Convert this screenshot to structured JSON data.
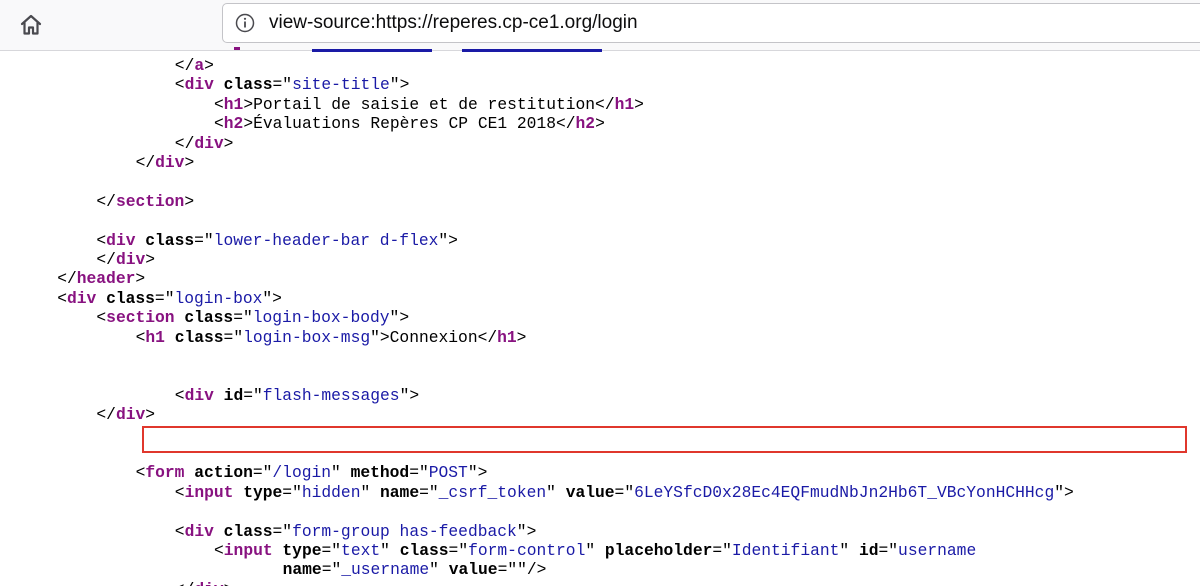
{
  "toolbar": {
    "home_icon": "home-icon",
    "info_icon": "info-circle-icon",
    "url": "view-source:https://reperes.cp-ce1.org/login"
  },
  "source_lines": [
    {
      "indent": 16,
      "parts": [
        {
          "c": "p",
          "t": "</"
        },
        {
          "c": "t",
          "t": "a"
        },
        {
          "c": "p",
          "t": ">"
        }
      ]
    },
    {
      "indent": 16,
      "parts": [
        {
          "c": "p",
          "t": "<"
        },
        {
          "c": "t",
          "t": "div "
        },
        {
          "c": "a",
          "t": "class"
        },
        {
          "c": "p",
          "t": "=\""
        },
        {
          "c": "v",
          "t": "site-title"
        },
        {
          "c": "p",
          "t": "\">"
        }
      ]
    },
    {
      "indent": 20,
      "parts": [
        {
          "c": "p",
          "t": "<"
        },
        {
          "c": "t",
          "t": "h1"
        },
        {
          "c": "p",
          "t": ">Portail de saisie et de restitution</"
        },
        {
          "c": "t",
          "t": "h1"
        },
        {
          "c": "p",
          "t": ">"
        }
      ]
    },
    {
      "indent": 20,
      "parts": [
        {
          "c": "p",
          "t": "<"
        },
        {
          "c": "t",
          "t": "h2"
        },
        {
          "c": "p",
          "t": ">Évaluations Repères CP CE1 2018</"
        },
        {
          "c": "t",
          "t": "h2"
        },
        {
          "c": "p",
          "t": ">"
        }
      ]
    },
    {
      "indent": 16,
      "parts": [
        {
          "c": "p",
          "t": "</"
        },
        {
          "c": "t",
          "t": "div"
        },
        {
          "c": "p",
          "t": ">"
        }
      ]
    },
    {
      "indent": 12,
      "parts": [
        {
          "c": "p",
          "t": "</"
        },
        {
          "c": "t",
          "t": "div"
        },
        {
          "c": "p",
          "t": ">"
        }
      ]
    },
    {
      "indent": 0,
      "parts": []
    },
    {
      "indent": 8,
      "parts": [
        {
          "c": "p",
          "t": "</"
        },
        {
          "c": "t",
          "t": "section"
        },
        {
          "c": "p",
          "t": ">"
        }
      ]
    },
    {
      "indent": 0,
      "parts": []
    },
    {
      "indent": 8,
      "parts": [
        {
          "c": "p",
          "t": "<"
        },
        {
          "c": "t",
          "t": "div "
        },
        {
          "c": "a",
          "t": "class"
        },
        {
          "c": "p",
          "t": "=\""
        },
        {
          "c": "v",
          "t": "lower-header-bar d-flex"
        },
        {
          "c": "p",
          "t": "\">"
        }
      ]
    },
    {
      "indent": 8,
      "parts": [
        {
          "c": "p",
          "t": "</"
        },
        {
          "c": "t",
          "t": "div"
        },
        {
          "c": "p",
          "t": ">"
        }
      ]
    },
    {
      "indent": 4,
      "parts": [
        {
          "c": "p",
          "t": "</"
        },
        {
          "c": "t",
          "t": "header"
        },
        {
          "c": "p",
          "t": ">"
        }
      ]
    },
    {
      "indent": 4,
      "parts": [
        {
          "c": "p",
          "t": "<"
        },
        {
          "c": "t",
          "t": "div "
        },
        {
          "c": "a",
          "t": "class"
        },
        {
          "c": "p",
          "t": "=\""
        },
        {
          "c": "v",
          "t": "login-box"
        },
        {
          "c": "p",
          "t": "\">"
        }
      ]
    },
    {
      "indent": 8,
      "parts": [
        {
          "c": "p",
          "t": "<"
        },
        {
          "c": "t",
          "t": "section "
        },
        {
          "c": "a",
          "t": "class"
        },
        {
          "c": "p",
          "t": "=\""
        },
        {
          "c": "v",
          "t": "login-box-body"
        },
        {
          "c": "p",
          "t": "\">"
        }
      ]
    },
    {
      "indent": 12,
      "parts": [
        {
          "c": "p",
          "t": "<"
        },
        {
          "c": "t",
          "t": "h1 "
        },
        {
          "c": "a",
          "t": "class"
        },
        {
          "c": "p",
          "t": "=\""
        },
        {
          "c": "v",
          "t": "login-box-msg"
        },
        {
          "c": "p",
          "t": "\">Connexion</"
        },
        {
          "c": "t",
          "t": "h1"
        },
        {
          "c": "p",
          "t": ">"
        }
      ]
    },
    {
      "indent": 0,
      "parts": []
    },
    {
      "indent": 0,
      "parts": []
    },
    {
      "indent": 16,
      "parts": [
        {
          "c": "p",
          "t": "<"
        },
        {
          "c": "t",
          "t": "div "
        },
        {
          "c": "a",
          "t": "id"
        },
        {
          "c": "p",
          "t": "=\""
        },
        {
          "c": "v",
          "t": "flash-messages"
        },
        {
          "c": "p",
          "t": "\">"
        }
      ]
    },
    {
      "indent": 8,
      "parts": [
        {
          "c": "p",
          "t": "</"
        },
        {
          "c": "t",
          "t": "div"
        },
        {
          "c": "p",
          "t": ">"
        }
      ]
    },
    {
      "indent": 0,
      "parts": []
    },
    {
      "indent": 0,
      "parts": []
    },
    {
      "indent": 12,
      "parts": [
        {
          "c": "p",
          "t": "<"
        },
        {
          "c": "t",
          "t": "form "
        },
        {
          "c": "a",
          "t": "action"
        },
        {
          "c": "p",
          "t": "=\""
        },
        {
          "c": "v",
          "t": "/login"
        },
        {
          "c": "p",
          "t": "\" "
        },
        {
          "c": "a",
          "t": "method"
        },
        {
          "c": "p",
          "t": "=\""
        },
        {
          "c": "v",
          "t": "POST"
        },
        {
          "c": "p",
          "t": "\">"
        }
      ]
    },
    {
      "indent": 16,
      "parts": [
        {
          "c": "p",
          "t": "<"
        },
        {
          "c": "t",
          "t": "input "
        },
        {
          "c": "a",
          "t": "type"
        },
        {
          "c": "p",
          "t": "=\""
        },
        {
          "c": "v",
          "t": "hidden"
        },
        {
          "c": "p",
          "t": "\" "
        },
        {
          "c": "a",
          "t": "name"
        },
        {
          "c": "p",
          "t": "=\""
        },
        {
          "c": "v",
          "t": "_csrf_token"
        },
        {
          "c": "p",
          "t": "\" "
        },
        {
          "c": "a",
          "t": "value"
        },
        {
          "c": "p",
          "t": "=\""
        },
        {
          "c": "v",
          "t": "6LeYSfcD0x28Ec4EQFmudNbJn2Hb6T_VBcYonHCHHcg"
        },
        {
          "c": "p",
          "t": "\">"
        }
      ]
    },
    {
      "indent": 0,
      "parts": []
    },
    {
      "indent": 16,
      "parts": [
        {
          "c": "p",
          "t": "<"
        },
        {
          "c": "t",
          "t": "div "
        },
        {
          "c": "a",
          "t": "class"
        },
        {
          "c": "p",
          "t": "=\""
        },
        {
          "c": "v",
          "t": "form-group has-feedback"
        },
        {
          "c": "p",
          "t": "\">"
        }
      ]
    },
    {
      "indent": 20,
      "parts": [
        {
          "c": "p",
          "t": "<"
        },
        {
          "c": "t",
          "t": "input "
        },
        {
          "c": "a",
          "t": "type"
        },
        {
          "c": "p",
          "t": "=\""
        },
        {
          "c": "v",
          "t": "text"
        },
        {
          "c": "p",
          "t": "\" "
        },
        {
          "c": "a",
          "t": "class"
        },
        {
          "c": "p",
          "t": "=\""
        },
        {
          "c": "v",
          "t": "form-control"
        },
        {
          "c": "p",
          "t": "\" "
        },
        {
          "c": "a",
          "t": "placeholder"
        },
        {
          "c": "p",
          "t": "=\""
        },
        {
          "c": "v",
          "t": "Identifiant"
        },
        {
          "c": "p",
          "t": "\" "
        },
        {
          "c": "a",
          "t": "id"
        },
        {
          "c": "p",
          "t": "=\""
        },
        {
          "c": "v",
          "t": "username"
        }
      ]
    },
    {
      "indent": 27,
      "parts": [
        {
          "c": "a",
          "t": "name"
        },
        {
          "c": "p",
          "t": "=\""
        },
        {
          "c": "v",
          "t": "_username"
        },
        {
          "c": "p",
          "t": "\" "
        },
        {
          "c": "a",
          "t": "value"
        },
        {
          "c": "p",
          "t": "=\""
        },
        {
          "c": "p",
          "t": "\"/>"
        }
      ]
    },
    {
      "indent": 16,
      "parts": [
        {
          "c": "p",
          "t": "</"
        },
        {
          "c": "t",
          "t": "div"
        },
        {
          "c": "p",
          "t": ">"
        }
      ]
    }
  ]
}
